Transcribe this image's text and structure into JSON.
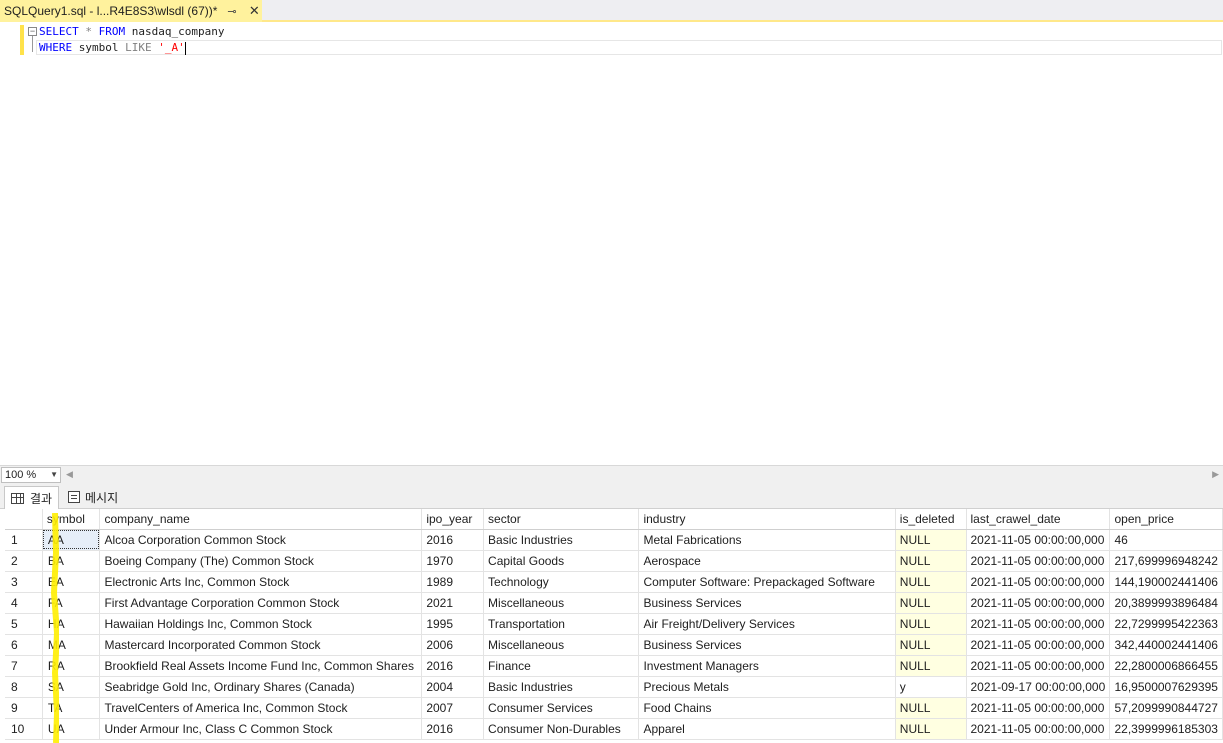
{
  "tab": {
    "title": "SQLQuery1.sql - l...R4E8S3\\wlsdl (67))*",
    "pin": "⊸",
    "close": "✕"
  },
  "editor": {
    "line1": {
      "kw1": "SELECT",
      "star": " * ",
      "kw2": "FROM",
      "table": " nasdaq_company"
    },
    "line2": {
      "kw1": "WHERE",
      "col": " symbol ",
      "op": "LIKE",
      "str": " '_A'"
    }
  },
  "zoom": {
    "value": "100 %"
  },
  "results_tabs": {
    "results_label": "결과",
    "messages_label": "메시지"
  },
  "grid": {
    "columns": [
      "symbol",
      "company_name",
      "ipo_year",
      "sector",
      "industry",
      "is_deleted",
      "last_crawel_date",
      "open_price"
    ],
    "rows": [
      [
        "1",
        "AA",
        "Alcoa Corporation Common Stock",
        "2016",
        "Basic Industries",
        "Metal Fabrications",
        "NULL",
        "2021-11-05 00:00:00,000",
        "46"
      ],
      [
        "2",
        "BA",
        "Boeing Company (The) Common Stock",
        "1970",
        "Capital Goods",
        "Aerospace",
        "NULL",
        "2021-11-05 00:00:00,000",
        "217,699996948242"
      ],
      [
        "3",
        "EA",
        "Electronic Arts Inc, Common Stock",
        "1989",
        "Technology",
        "Computer Software: Prepackaged Software",
        "NULL",
        "2021-11-05 00:00:00,000",
        "144,190002441406"
      ],
      [
        "4",
        "FA",
        "First Advantage Corporation Common Stock",
        "2021",
        "Miscellaneous",
        "Business Services",
        "NULL",
        "2021-11-05 00:00:00,000",
        "20,3899993896484"
      ],
      [
        "5",
        "HA",
        "Hawaiian Holdings Inc, Common Stock",
        "1995",
        "Transportation",
        "Air Freight/Delivery Services",
        "NULL",
        "2021-11-05 00:00:00,000",
        "22,7299995422363"
      ],
      [
        "6",
        "MA",
        "Mastercard Incorporated Common Stock",
        "2006",
        "Miscellaneous",
        "Business Services",
        "NULL",
        "2021-11-05 00:00:00,000",
        "342,440002441406"
      ],
      [
        "7",
        "RA",
        "Brookfield Real Assets Income Fund Inc, Common Shares",
        "2016",
        "Finance",
        "Investment Managers",
        "NULL",
        "2021-11-05 00:00:00,000",
        "22,2800006866455"
      ],
      [
        "8",
        "SA",
        "Seabridge Gold Inc, Ordinary Shares (Canada)",
        "2004",
        "Basic Industries",
        "Precious Metals",
        "y",
        "2021-09-17 00:00:00,000",
        "16,9500007629395"
      ],
      [
        "9",
        "TA",
        "TravelCenters of America Inc, Common Stock",
        "2007",
        "Consumer Services",
        "Food Chains",
        "NULL",
        "2021-11-05 00:00:00,000",
        "57,2099990844727"
      ],
      [
        "10",
        "UA",
        "Under Armour Inc, Class C Common Stock",
        "2016",
        "Consumer Non-Durables",
        "Apparel",
        "NULL",
        "2021-11-05 00:00:00,000",
        "22,3999996185303"
      ]
    ]
  },
  "colors": {
    "tab_active": "#fff29d",
    "null_cell": "#ffffe1",
    "highlight_mark": "#ffee00",
    "keyword": "#0000ff",
    "string": "#ff0000"
  }
}
